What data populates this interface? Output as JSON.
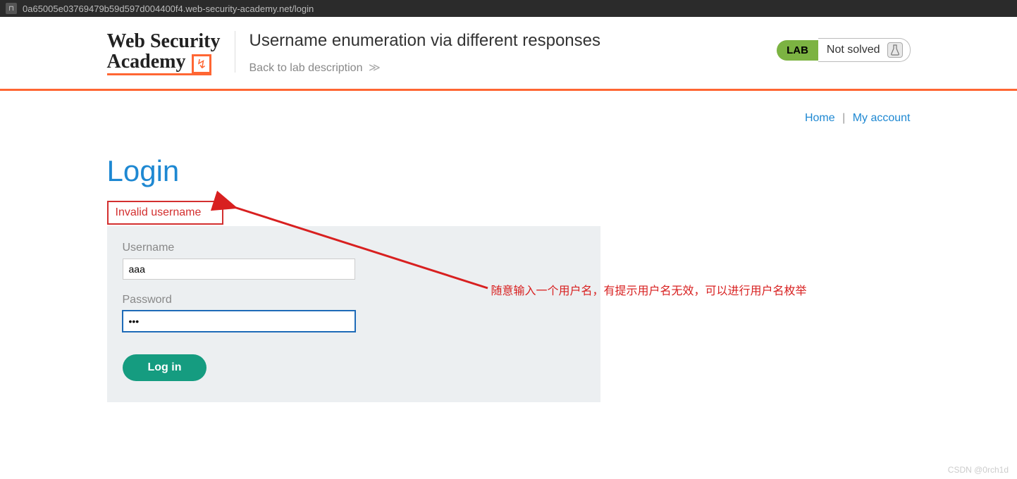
{
  "url": "0a65005e03769479b59d597d004400f4.web-security-academy.net/login",
  "logo": {
    "line1": "Web Security",
    "line2": "Academy"
  },
  "lab": {
    "title": "Username enumeration via different responses",
    "back_link": "Back to lab description",
    "badge": "LAB",
    "status": "Not solved"
  },
  "nav": {
    "home": "Home",
    "account": "My account",
    "sep": "|"
  },
  "page": {
    "title": "Login"
  },
  "error": "Invalid username",
  "form": {
    "username_label": "Username",
    "username_value": "aaa",
    "password_label": "Password",
    "password_value": "•••",
    "submit": "Log in"
  },
  "annotation": "随意输入一个用户名，有提示用户名无效，可以进行用户名枚举",
  "watermark": "CSDN @0rch1d"
}
